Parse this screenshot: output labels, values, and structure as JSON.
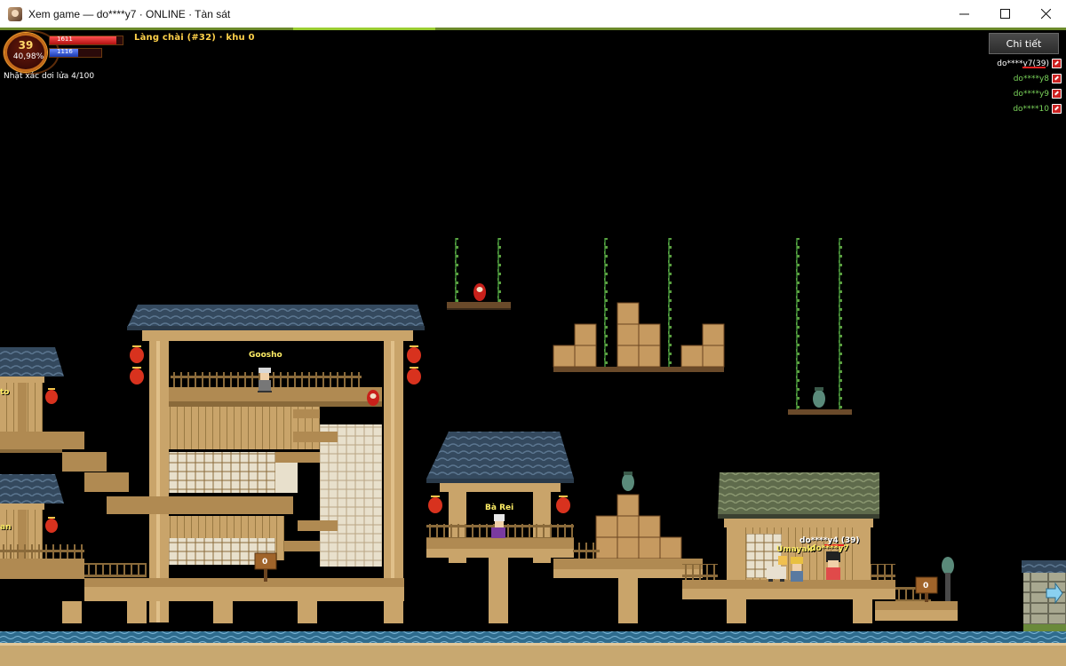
{
  "window": {
    "title": "Xem game — do****y7  ·  ONLINE · Tàn sát"
  },
  "hud": {
    "level": "39",
    "exp_percent": "40,98%",
    "hp_value": "1611",
    "mp_value": "1116",
    "hp_fill": 0.92,
    "mp_fill": 0.55,
    "map_name": "Làng chài (#32)  ·  khu 0",
    "quest_text": "Nhặt xác dơi lửa 4/100",
    "details_button": "Chi tiết"
  },
  "party": [
    {
      "name": "do****y7(39)",
      "color": "#ffffff"
    },
    {
      "name": "do****y8",
      "color": "#7ad35a"
    },
    {
      "name": "do****y9",
      "color": "#7ad35a"
    },
    {
      "name": "do****10",
      "color": "#7ad35a"
    }
  ],
  "npcs": {
    "goosho": "Goosho",
    "ba_rei": "Bà Rei",
    "umayaki": "Umayaki",
    "left_cut_1": "to",
    "left_cut_2": "an"
  },
  "players": {
    "label_overlap": "do****y4 (39)",
    "label_self": "do****y7"
  },
  "signs": {
    "sign1": "0",
    "sign2": "0"
  },
  "colors": {
    "roof_blue": "#3d566e",
    "roof_green": "#6f7a5a",
    "wood": "#c9a46a",
    "wood_dark": "#8a6a3a",
    "water": "#3a7aa0",
    "ground": "#c8a870",
    "npc_name": "#ffee66"
  }
}
